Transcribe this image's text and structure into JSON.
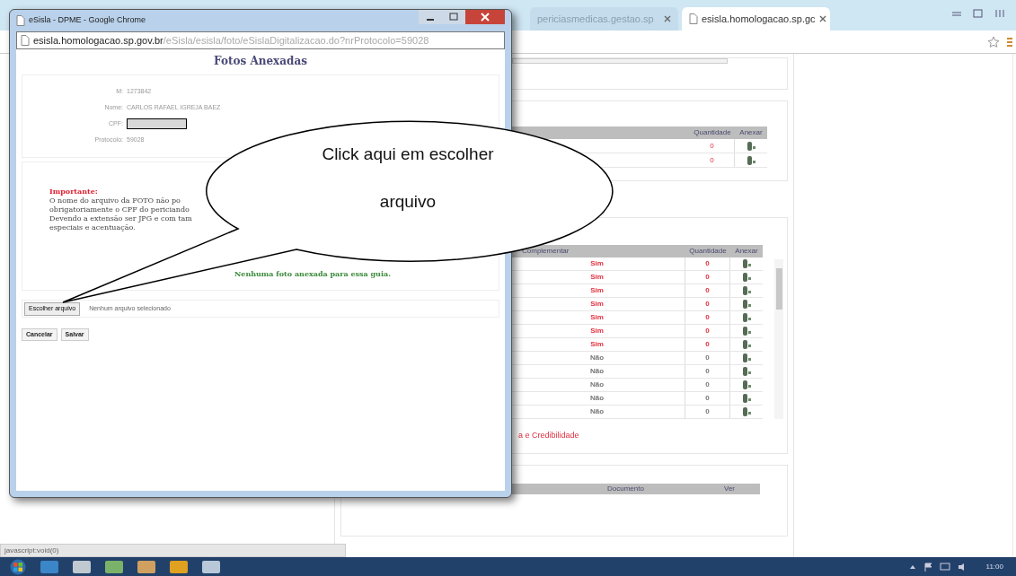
{
  "browser": {
    "tabs": [
      {
        "label": "periciasmedicas.gestao.sp",
        "selected": false
      },
      {
        "label": "esisla.homologacao.sp.gc",
        "selected": true
      }
    ]
  },
  "background_page": {
    "table_1": {
      "columns": [
        "Quantidade",
        "Anexar"
      ],
      "rows": [
        {
          "quantity": "0"
        },
        {
          "quantity": "0"
        }
      ]
    },
    "table_2": {
      "columns": [
        "Complementar",
        "Quantidade",
        "Anexar"
      ],
      "rows": [
        {
          "value": "Sim",
          "quantity": "0",
          "color": "#e03040"
        },
        {
          "value": "Sim",
          "quantity": "0",
          "color": "#e03040"
        },
        {
          "value": "Sim",
          "quantity": "0",
          "color": "#e03040"
        },
        {
          "value": "Sim",
          "quantity": "0",
          "color": "#e03040"
        },
        {
          "value": "Sim",
          "quantity": "0",
          "color": "#e03040"
        },
        {
          "value": "Sim",
          "quantity": "0",
          "color": "#e03040"
        },
        {
          "value": "Sim",
          "quantity": "0",
          "color": "#e03040"
        },
        {
          "value": "Não",
          "quantity": "0",
          "color": "#777777"
        },
        {
          "value": "Não",
          "quantity": "0",
          "color": "#777777"
        },
        {
          "value": "Não",
          "quantity": "0",
          "color": "#777777"
        },
        {
          "value": "Não",
          "quantity": "0",
          "color": "#777777"
        },
        {
          "value": "Não",
          "quantity": "0",
          "color": "#777777"
        }
      ]
    },
    "link": "a e Credibilidade",
    "table_3": {
      "columns": [
        "Documento",
        "Ver"
      ]
    }
  },
  "popup": {
    "title": "eSisla - DPME - Google Chrome",
    "url_host": "esisla.homologacao.sp.gov.br",
    "url_path": "/eSisla/esisla/foto/eSislaDigitalizacao.do?nrProtocolo=59028",
    "heading": "Fotos Anexadas",
    "fields": [
      {
        "kind": "text",
        "label": "M:",
        "value": "1273842"
      },
      {
        "kind": "text",
        "label": "Nome:",
        "value": "CARLOS RAFAEL IGREJA BAEZ"
      },
      {
        "kind": "redacted",
        "label": "CPF:"
      },
      {
        "kind": "text",
        "label": "Protocolo:",
        "value": "59028"
      }
    ],
    "notice": {
      "title": "Importante:",
      "lines": [
        "O nome do arquivo da FOTO não po",
        "obrigatoriamente o CPF do periciando",
        "Devendo a extensão ser JPG e com tam",
        "especiais e acentuação."
      ]
    },
    "empty_message": "Nenhuma foto anexada para essa guia.",
    "file_input": {
      "button": "Escolher arquivo",
      "status": "Nenhum arquivo selecionado"
    },
    "buttons": [
      "Cancelar",
      "Salvar"
    ]
  },
  "callout": {
    "lines": [
      "Click aqui em escolher",
      "arquivo"
    ]
  },
  "status_bar": "javascript:void(0)",
  "taskbar": {
    "clock": "11:00"
  }
}
